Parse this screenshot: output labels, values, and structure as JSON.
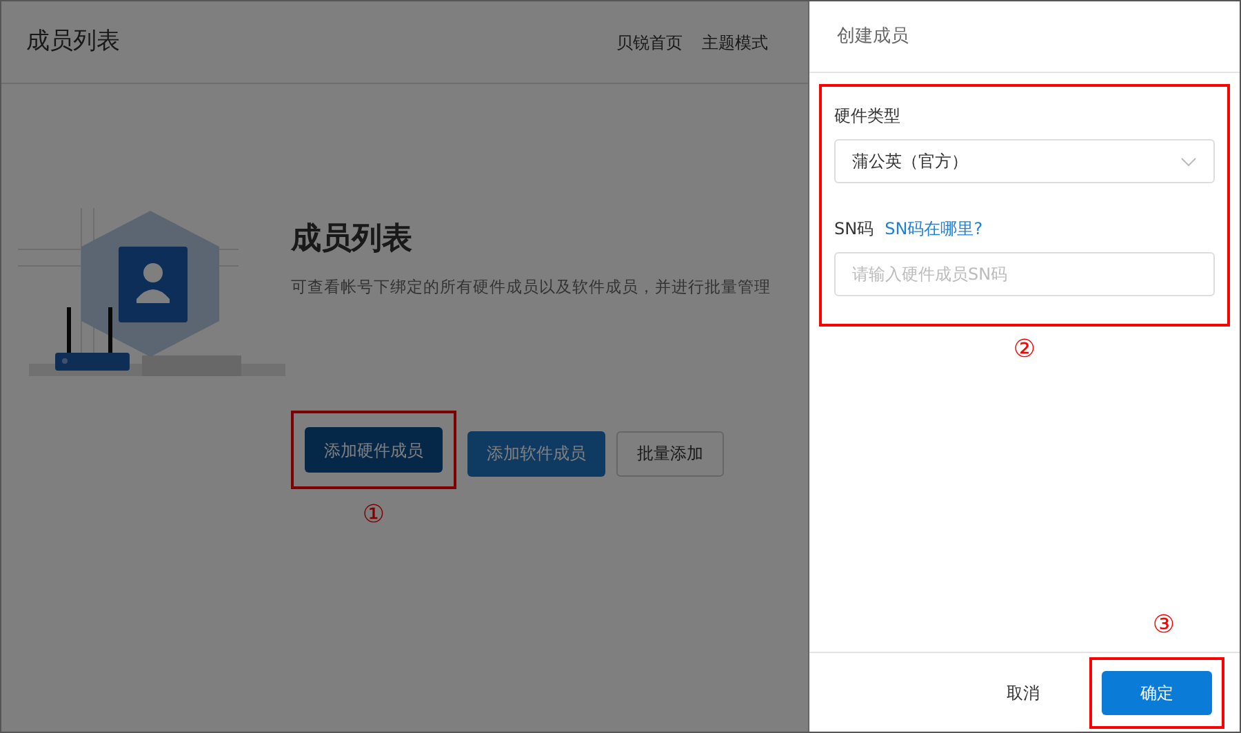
{
  "page": {
    "title": "成员列表",
    "nav": [
      {
        "label": "贝锐首页"
      },
      {
        "label": "主题模式"
      }
    ],
    "heading": "成员列表",
    "description": "可查看帐号下绑定的所有硬件成员以及软件成员，并进行批量管理",
    "buttons": [
      {
        "label": "添加硬件成员",
        "kind": "dark"
      },
      {
        "label": "添加软件成员",
        "kind": "primary"
      },
      {
        "label": "批量添加",
        "kind": "outline"
      }
    ]
  },
  "drawer": {
    "title": "创建成员",
    "fields": [
      {
        "kind": "select",
        "label": "硬件类型",
        "value": "蒲公英（官方）"
      },
      {
        "kind": "input",
        "label": "SN码",
        "link": "SN码在哪里?",
        "placeholder": "请输入硬件成员SN码"
      }
    ],
    "cancel": "取消",
    "confirm": "确定"
  },
  "annotations": [
    "①",
    "②",
    "③"
  ]
}
